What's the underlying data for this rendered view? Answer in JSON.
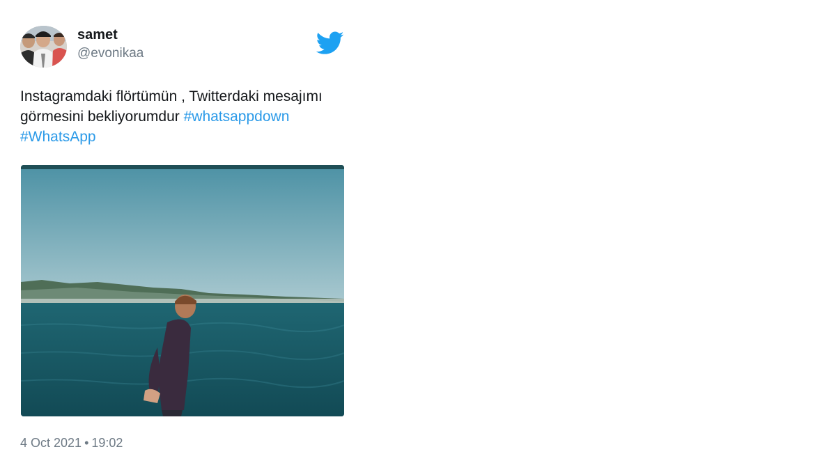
{
  "tweet": {
    "user": {
      "display_name": "samet",
      "handle": "@evonikaa",
      "avatar_icon": "group-photo-avatar"
    },
    "brand_icon": "twitter-bird-icon",
    "brand_color": "#1da1f2",
    "text": {
      "body": "Instagramdaki flörtümün , Twitterdaki mesajımı görmesini bekliyorumdur ",
      "hashtags": [
        "#whatsappdown",
        "#WhatsApp"
      ]
    },
    "hashtag_color": "#2b9ae8",
    "media": {
      "type": "image",
      "subject": "man-standing-by-sea-photo"
    },
    "timestamp": {
      "date": "4 Oct 2021",
      "separator": "•",
      "time": "19:02"
    }
  }
}
